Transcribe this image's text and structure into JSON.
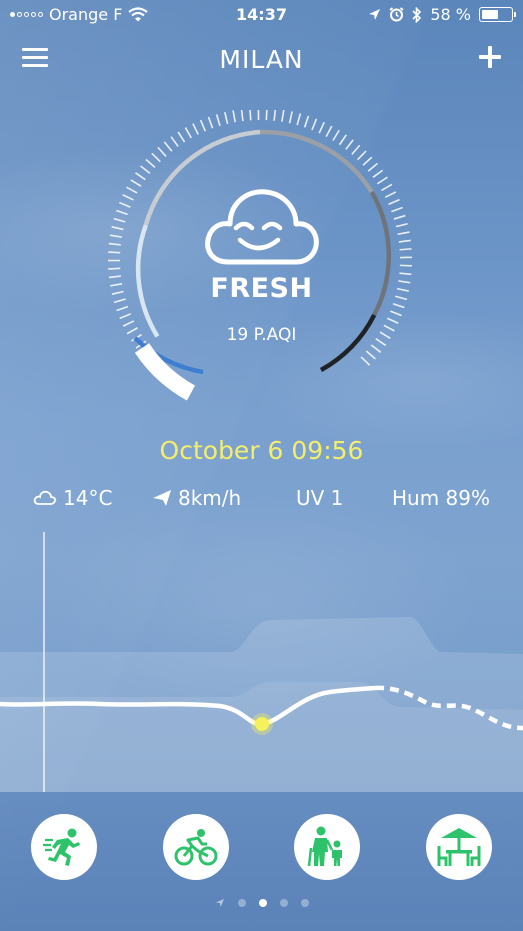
{
  "status_bar": {
    "carrier": "Orange F",
    "time": "14:37",
    "battery": "58 %",
    "battery_level": 0.58
  },
  "header": {
    "city": "MILAN",
    "menu_icon": "hamburger-menu-icon",
    "add_icon": "plus-icon"
  },
  "air_quality": {
    "label": "FRESH",
    "value": "19 P.AQI",
    "icon": "smiling-cloud-icon"
  },
  "datetime": "October 6 09:56",
  "metrics": {
    "temperature": "14°C",
    "wind": "8km/h",
    "uv": "UV 1",
    "humidity": "Hum 89%"
  },
  "colors": {
    "date_yellow": "#f4ee6a",
    "accent_green": "#2ec36b",
    "marker_yellow": "#f6f05a"
  },
  "activities": [
    {
      "icon": "running-person-icon"
    },
    {
      "icon": "cyclist-icon"
    },
    {
      "icon": "elderly-and-child-icon"
    },
    {
      "icon": "outdoor-table-umbrella-icon"
    }
  ],
  "pager": {
    "pages": 4,
    "active_page": 1,
    "location_icon": "location-arrow-icon"
  }
}
